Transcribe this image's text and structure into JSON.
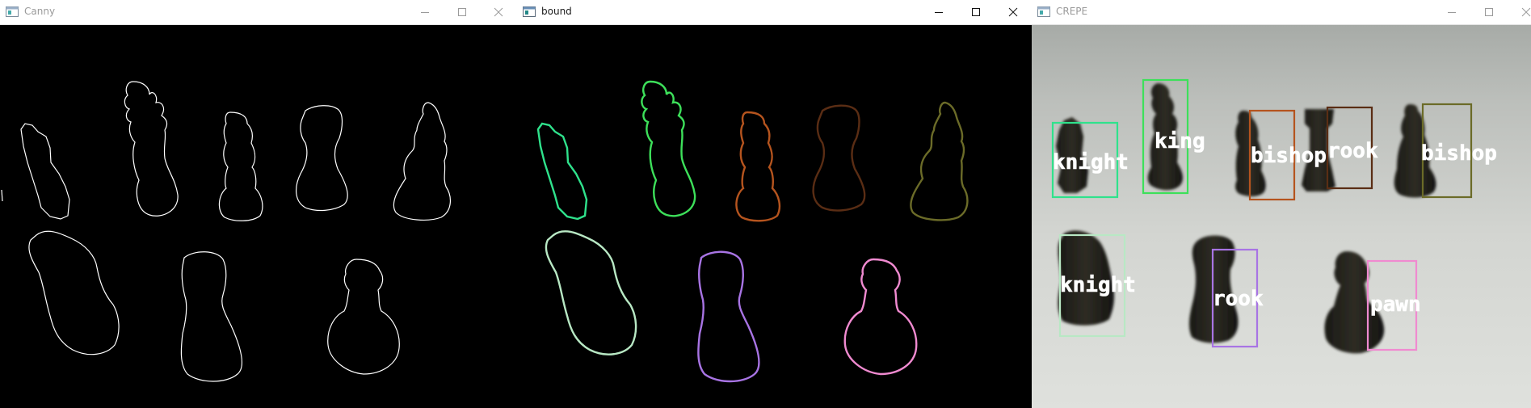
{
  "windows": [
    {
      "id": "canny",
      "title": "Canny",
      "active": false
    },
    {
      "id": "bound",
      "title": "bound",
      "active": true
    },
    {
      "id": "crepe",
      "title": "CREPE",
      "active": false
    }
  ],
  "colors": {
    "edge": "#ffffff",
    "knight_top": "#2fe28c",
    "king": "#3de05a",
    "bishop_1": "#b5541e",
    "rook_top": "#5a2d14",
    "bishop_2": "#6b6b28",
    "knight_bottom": "#b8e8c4",
    "rook_bottom": "#a874e4",
    "pawn": "#f08ad0"
  },
  "labels": [
    {
      "id": "knight-top",
      "text": "knight"
    },
    {
      "id": "king",
      "text": "king"
    },
    {
      "id": "bishop-1",
      "text": "bishop"
    },
    {
      "id": "rook-top",
      "text": "rook"
    },
    {
      "id": "bishop-2",
      "text": "bishop"
    },
    {
      "id": "knight-bottom",
      "text": "knight"
    },
    {
      "id": "rook-bottom",
      "text": "rook"
    },
    {
      "id": "pawn",
      "text": "pawn"
    }
  ]
}
